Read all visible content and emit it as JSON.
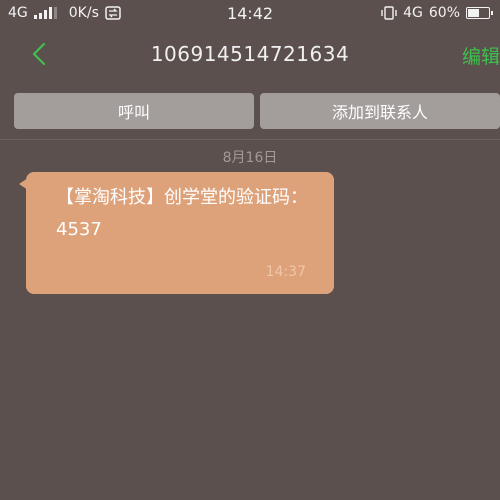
{
  "status_bar": {
    "network": "4G",
    "speed": "0K/s",
    "time": "14:42",
    "network_right": "4G",
    "battery_percent": "60%",
    "battery_level": 0.6
  },
  "header": {
    "title": "106914514721634",
    "edit_label": "编辑"
  },
  "actions": {
    "call_label": "呼叫",
    "add_contact_label": "添加到联系人"
  },
  "conversation": {
    "date": "8月16日",
    "messages": [
      {
        "text": "【掌淘科技】创学堂的验证码：4537",
        "time": "14:37"
      }
    ]
  },
  "colors": {
    "background": "#5b504d",
    "accent": "#3fbf4e",
    "bubble": "#dea27a",
    "button": "#a39d9b"
  }
}
